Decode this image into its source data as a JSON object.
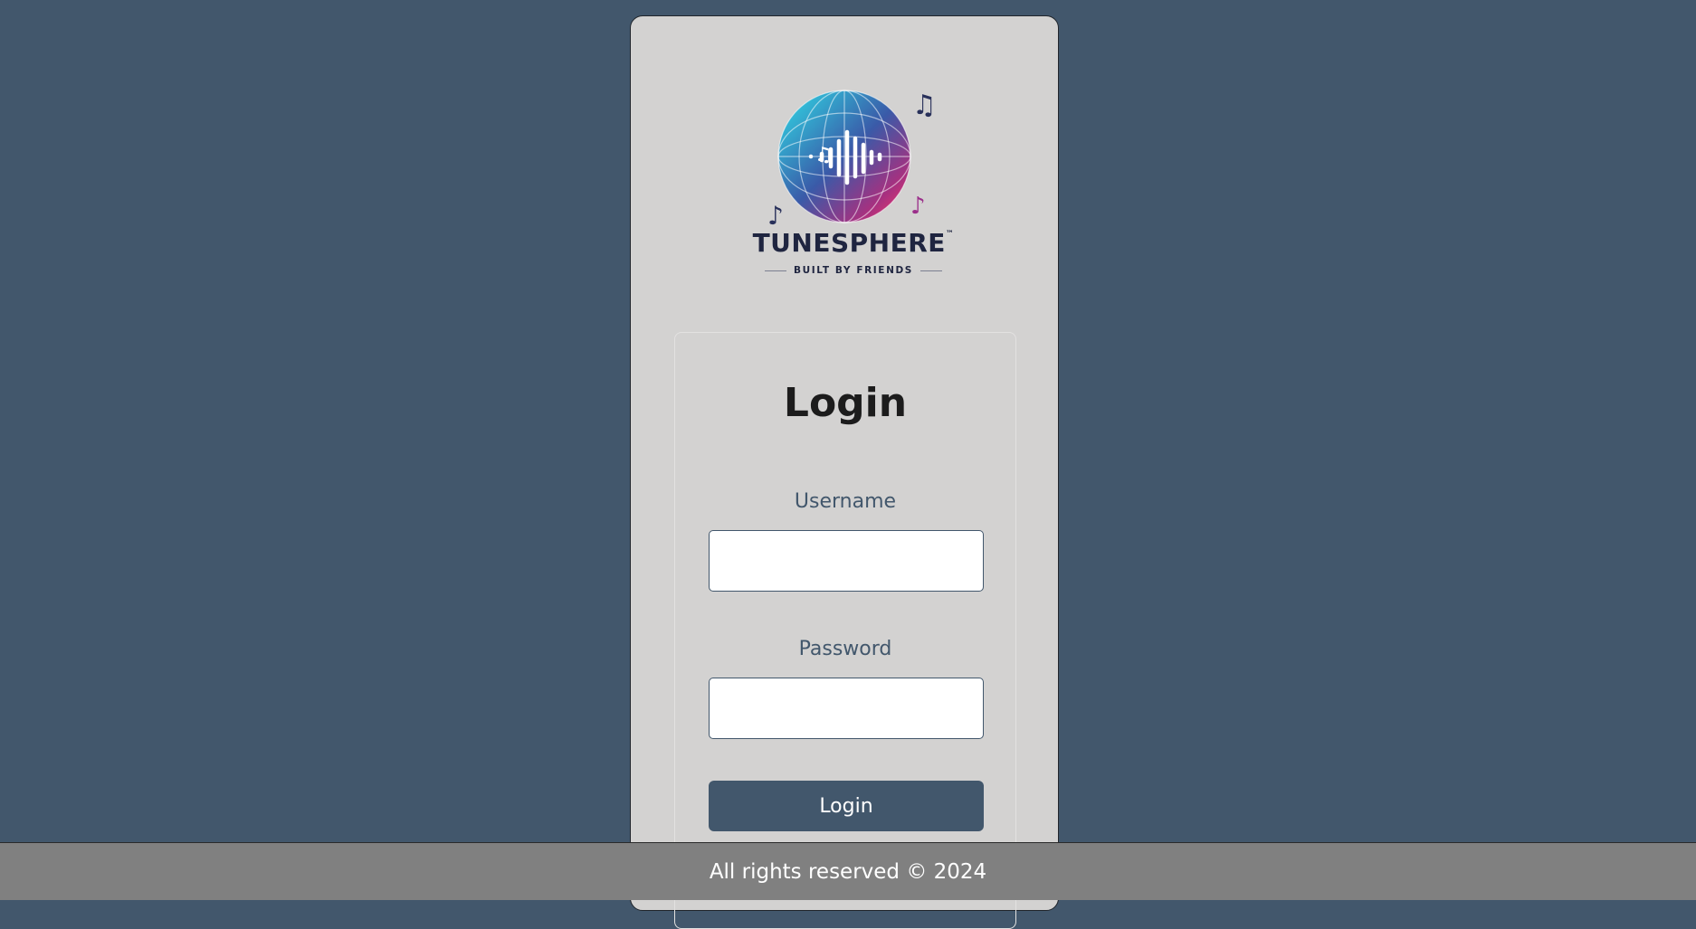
{
  "brand": {
    "name": "TUNESPHERE",
    "trademark": "™",
    "tagline": "BUILT BY FRIENDS",
    "logo_icon": "music-globe-icon"
  },
  "login": {
    "title": "Login",
    "username_label": "Username",
    "username_value": "",
    "password_label": "Password",
    "password_value": "",
    "submit_label": "Login"
  },
  "footer": {
    "text": "All rights reserved © 2024"
  },
  "colors": {
    "background": "#42576c",
    "panel": "#d3d2d1",
    "accent": "#42576c",
    "footer": "#808080",
    "globe_gradient": [
      "#2fd6e6",
      "#3b5fb0",
      "#e8336f"
    ]
  }
}
